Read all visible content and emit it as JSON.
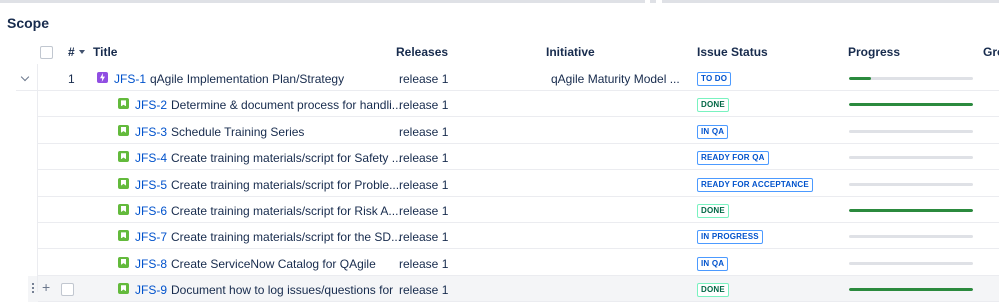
{
  "scope": {
    "title": "Scope"
  },
  "columns": {
    "number": "#",
    "title": "Title",
    "releases": "Releases",
    "initiative": "Initiative",
    "issue_status": "Issue Status",
    "progress": "Progress",
    "group_partial": "Gro"
  },
  "rows": [
    {
      "number": "1",
      "key": "JFS-1",
      "type": "epic",
      "title": "qAgile Implementation Plan/Strategy",
      "release": "release 1",
      "initiative": "qAgile Maturity Model ...",
      "status": "TO DO",
      "progress": 0.18
    },
    {
      "number": "",
      "key": "JFS-2",
      "type": "story",
      "title": "Determine & document process for handli...",
      "release": "release 1",
      "initiative": "",
      "status": "DONE",
      "progress": 1.0
    },
    {
      "number": "",
      "key": "JFS-3",
      "type": "story",
      "title": "Schedule Training Series",
      "release": "release 1",
      "initiative": "",
      "status": "IN QA",
      "progress": 0
    },
    {
      "number": "",
      "key": "JFS-4",
      "type": "story",
      "title": "Create training materials/script for Safety ...",
      "release": "release 1",
      "initiative": "",
      "status": "READY FOR QA",
      "progress": 0
    },
    {
      "number": "",
      "key": "JFS-5",
      "type": "story",
      "title": "Create training materials/script for Proble...",
      "release": "release 1",
      "initiative": "",
      "status": "READY FOR ACCEPTANCE",
      "progress": 0
    },
    {
      "number": "",
      "key": "JFS-6",
      "type": "story",
      "title": "Create training materials/script for Risk A...",
      "release": "release 1",
      "initiative": "",
      "status": "DONE",
      "progress": 1.0
    },
    {
      "number": "",
      "key": "JFS-7",
      "type": "story",
      "title": "Create training materials/script for the SD...",
      "release": "release 1",
      "initiative": "",
      "status": "IN PROGRESS",
      "progress": 0
    },
    {
      "number": "",
      "key": "JFS-8",
      "type": "story",
      "title": "Create ServiceNow Catalog for QAgile",
      "release": "release 1",
      "initiative": "",
      "status": "IN QA",
      "progress": 0
    },
    {
      "number": "",
      "key": "JFS-9",
      "type": "story",
      "title": "Document how to log issues/questions for",
      "release": "release 1",
      "initiative": "",
      "status": "DONE",
      "progress": 1.0
    }
  ],
  "colors": {
    "accent_blue": "#0052cc",
    "done_green": "#006644",
    "progress_green": "#2b8a3e",
    "story_icon": "#63ba3c",
    "epic_icon": "#904ee2"
  }
}
